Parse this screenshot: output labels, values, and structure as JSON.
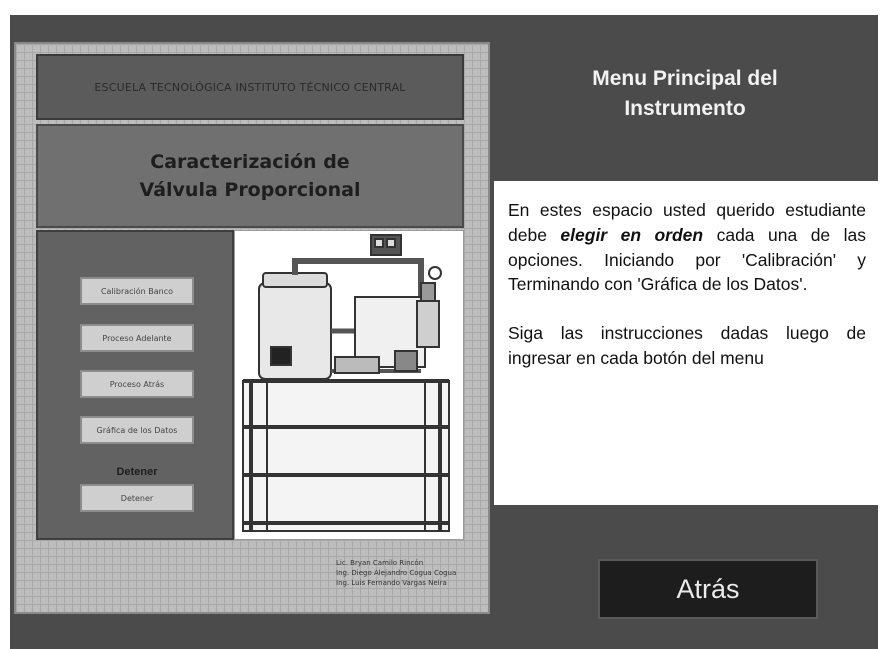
{
  "header": {
    "institution": "ESCUELA TECNOLÓGICA INSTITUTO TÉCNICO CENTRAL",
    "title_line1": "Caracterización de",
    "title_line2": "Válvula Proporcional"
  },
  "buttons": {
    "calibracion": "Calibración Banco",
    "adelante": "Proceso Adelante",
    "atras": "Proceso Atrás",
    "grafica": "Gráfica de los Datos",
    "detener_label": "Detener",
    "detener": "Detener"
  },
  "credits": [
    "Lic. Bryan Camilo Rincón",
    "Ing. Diego Alejandro Cogua Cogua",
    "Ing. Luis Fernando Vargas Neira"
  ],
  "menu": {
    "title_line1": "Menu Principal del",
    "title_line2": "Instrumento"
  },
  "info": {
    "p1_before": "En estes espacio usted querido estudiante debe ",
    "p1_emphasis": "elegir en orden",
    "p1_after": " cada una de las opciones. Iniciando por 'Calibración' y Terminando con 'Gráfica de los Datos'.",
    "p2": "Siga las instrucciones dadas luego de ingresar en cada botón del menu"
  },
  "back_button": "Atrás",
  "colors": {
    "frame": "#4b4b4b",
    "grid_panel": "#bdbdbd",
    "info_bg": "#ffffff",
    "back_button_bg": "#1d1d1d"
  }
}
